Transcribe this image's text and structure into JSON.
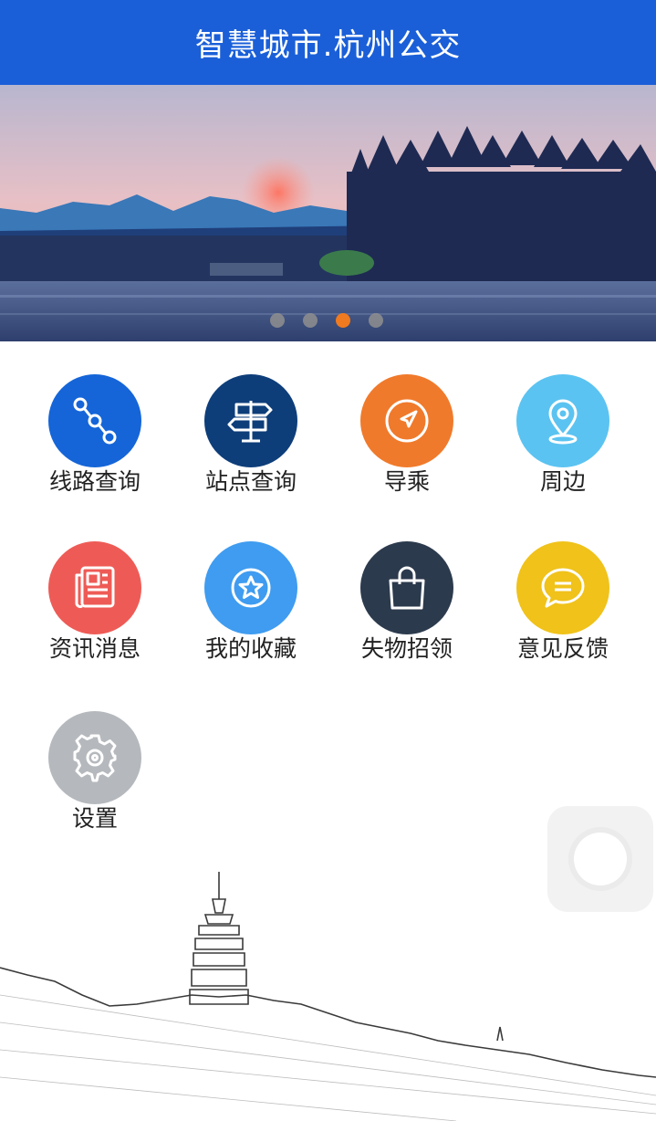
{
  "header": {
    "title": "智慧城市.杭州公交"
  },
  "banner": {
    "slide_count": 4,
    "active_slide_index": 2,
    "colors": {
      "active_dot": "#f07a1f",
      "inactive_dot": "#8f8f8f"
    }
  },
  "grid": {
    "items": [
      {
        "label": "线路查询",
        "icon": "route-icon",
        "color": "#1565d8"
      },
      {
        "label": "站点查询",
        "icon": "signpost-icon",
        "color": "#0e3e7a"
      },
      {
        "label": "导乘",
        "icon": "navigation-arrow-icon",
        "color": "#f07a2b"
      },
      {
        "label": "周边",
        "icon": "location-pin-icon",
        "color": "#5bc3f1"
      },
      {
        "label": "资讯消息",
        "icon": "newspaper-icon",
        "color": "#ee5b56"
      },
      {
        "label": "我的收藏",
        "icon": "star-icon",
        "color": "#3f9cf0"
      },
      {
        "label": "失物招领",
        "icon": "shopping-bag-icon",
        "color": "#2c3a4d"
      },
      {
        "label": "意见反馈",
        "icon": "chat-bubble-icon",
        "color": "#f0c21a"
      },
      {
        "label": "设置",
        "icon": "gear-icon",
        "color": "#b5b9bd"
      }
    ]
  },
  "theme": {
    "header_bg": "#1a5fd8"
  }
}
